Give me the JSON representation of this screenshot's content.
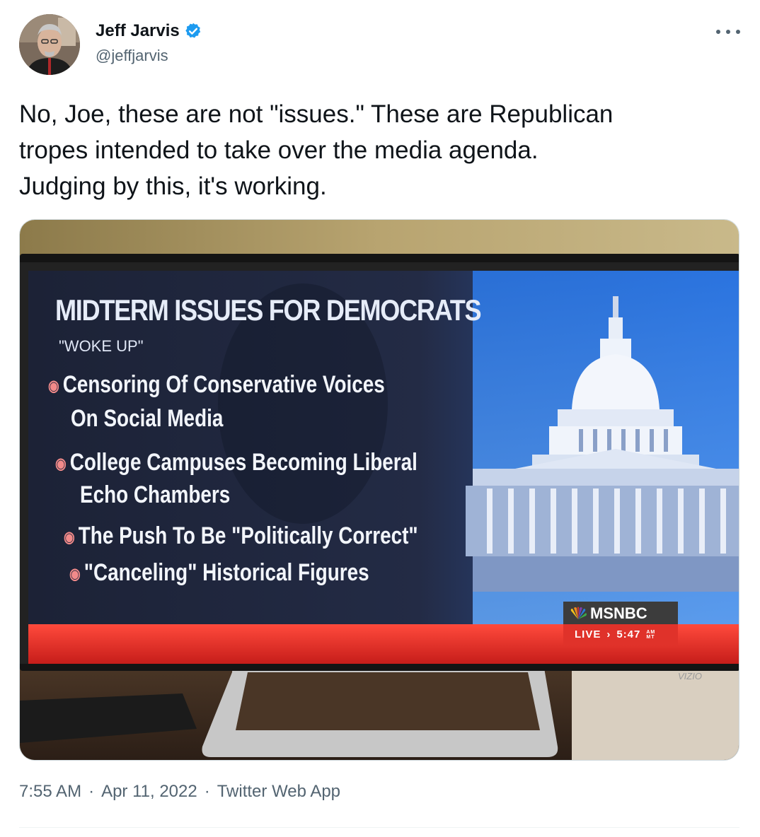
{
  "author": {
    "display_name": "Jeff Jarvis",
    "handle": "@jeffjarvis",
    "verified_icon": "verified-badge-icon",
    "badge_color": "#1d9bf0"
  },
  "tweet": {
    "text_lines": [
      "No, Joe, these are not \"issues.\" These are Republican",
      "tropes intended to take over the media agenda.",
      "Judging by this, it's working."
    ]
  },
  "tv_graphic": {
    "title": "MIDTERM ISSUES FOR DEMOCRATS",
    "subtitle": "\"WOKE UP\"",
    "bullets": [
      "Censoring Of Conservative Voices",
      "On Social Media",
      "College Campuses Becoming Liberal",
      "Echo Chambers",
      "The Push To Be \"Politically Correct\"",
      "\"Canceling\" Historical Figures"
    ],
    "network": "MSNBC",
    "live_label": "LIVE",
    "time": "5:47",
    "ampm": "AM\nMT",
    "tv_brand": "VIZIO"
  },
  "meta": {
    "time": "7:55 AM",
    "date": "Apr 11, 2022",
    "source": "Twitter Web App",
    "separator": "·"
  }
}
